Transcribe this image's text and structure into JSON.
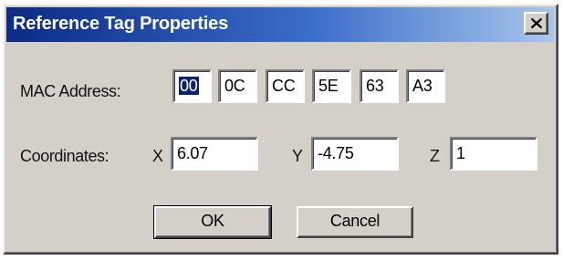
{
  "window": {
    "title": "Reference Tag Properties",
    "close_label": "x"
  },
  "mac": {
    "label": "MAC Address:",
    "octets": [
      "00",
      "0C",
      "CC",
      "5E",
      "63",
      "A3"
    ]
  },
  "coordinates": {
    "label": "Coordinates:",
    "x_label": "X",
    "x_value": "6.07",
    "y_label": "Y",
    "y_value": "-4.75",
    "z_label": "Z",
    "z_value": "1"
  },
  "buttons": {
    "ok": "OK",
    "cancel": "Cancel"
  },
  "colors": {
    "titlebar_start": "#0b2b84",
    "titlebar_end": "#a7c6ec",
    "dialog_face": "#d4d0c8",
    "selection": "#0a246a"
  }
}
